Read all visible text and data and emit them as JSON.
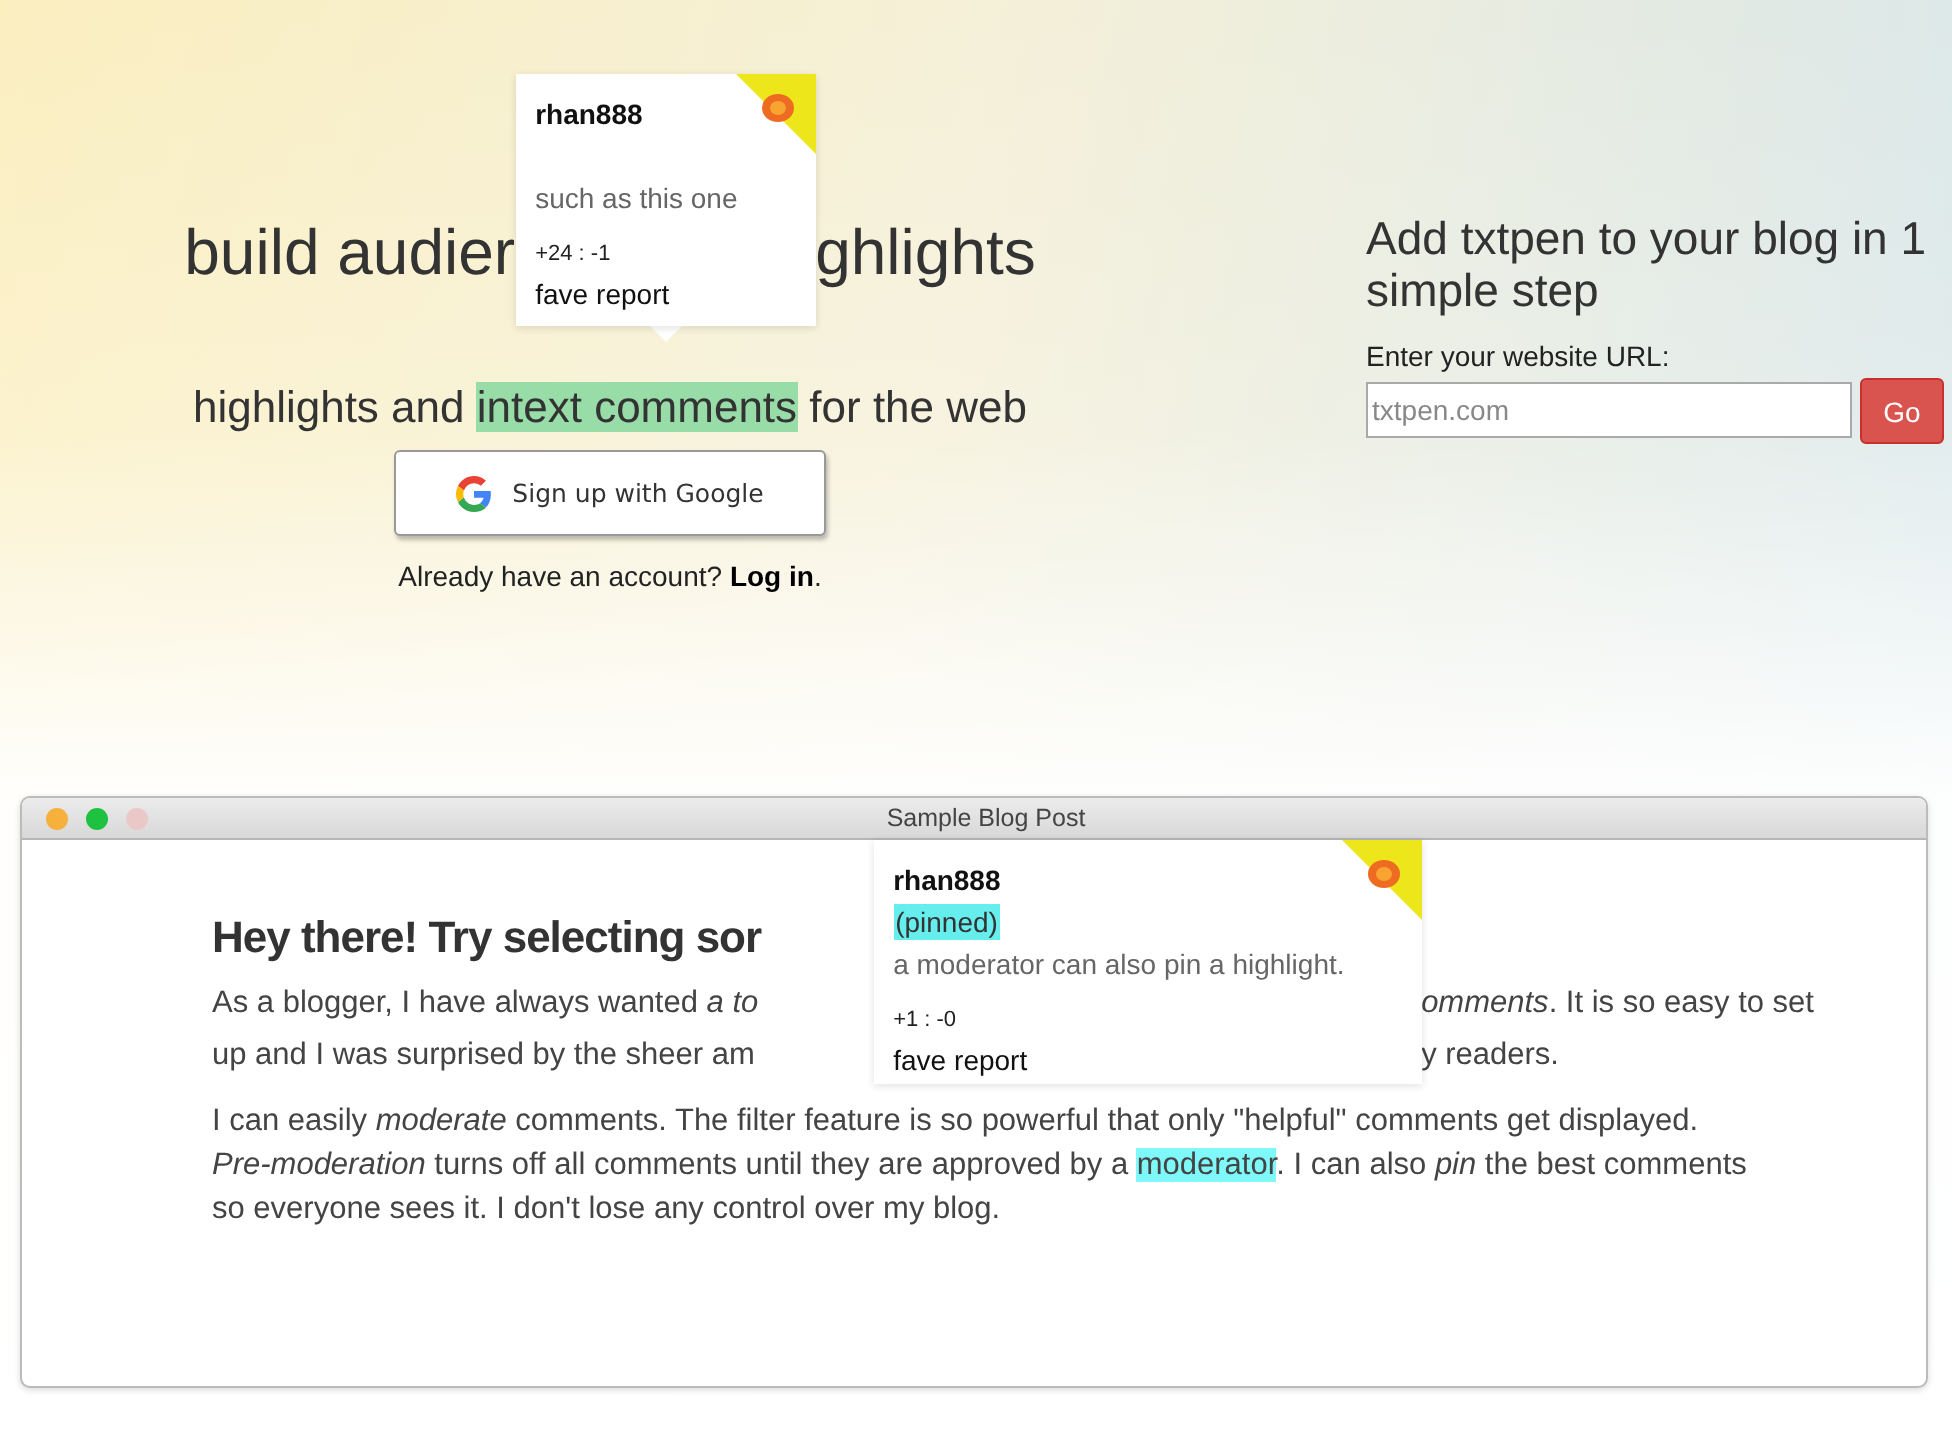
{
  "hero": {
    "title_parts": [
      "build audier",
      "ghlights"
    ],
    "comment_popup": {
      "username": "rhan888",
      "body": "such as this one",
      "votes": "+24 : -1",
      "actions": [
        "fave",
        "report"
      ]
    },
    "subtitle": [
      {
        "text": "highlights and ",
        "highlighted": false
      },
      {
        "text": "intext comments",
        "highlighted": true
      },
      {
        "text": " for the web",
        "highlighted": false
      }
    ],
    "google_button": "Sign up with Google",
    "login_prompt": {
      "text": "Already have an account? ",
      "link": "Log in",
      "after": "."
    }
  },
  "signup": {
    "title": "Add txtpen to your blog in 1 simple step",
    "url_label": "Enter your website URL:",
    "url_placeholder": "txtpen.com",
    "go_button": "Go"
  },
  "window": {
    "title": "Sample Blog Post",
    "controls": [
      {
        "color": "#f6b03c"
      },
      {
        "color": "#1ec140"
      },
      {
        "color": "#eac8c8"
      }
    ]
  },
  "blog": {
    "heading": "Hey there! Try selecting sor",
    "rows": [
      {
        "left": "As a blogger, I have always wanted *a to*",
        "right": "*omments*. It is so easy to set"
      },
      {
        "left": "up and I was surprised by the sheer am",
        "right": "y readers."
      }
    ],
    "paragraph": [
      {
        "text": "I can easily *moderate* comments. The filter feature is so powerful that only \"helpful\" comments get displayed. *Pre-moderation* turns off all comments until they are approved by a ",
        "highlighted": false
      },
      {
        "text": "moderator",
        "highlighted": true
      },
      {
        "text": ". I can also *pin* the best comments so everyone sees it. I don't lose any control over my blog.",
        "highlighted": false
      }
    ],
    "comment_popup": {
      "username": "rhan888",
      "pinned": true,
      "pinned_label": "(pinned)",
      "body": "a moderator can also pin a highlight.",
      "votes": "+1 : -0",
      "actions": [
        "fave",
        "report"
      ]
    }
  }
}
